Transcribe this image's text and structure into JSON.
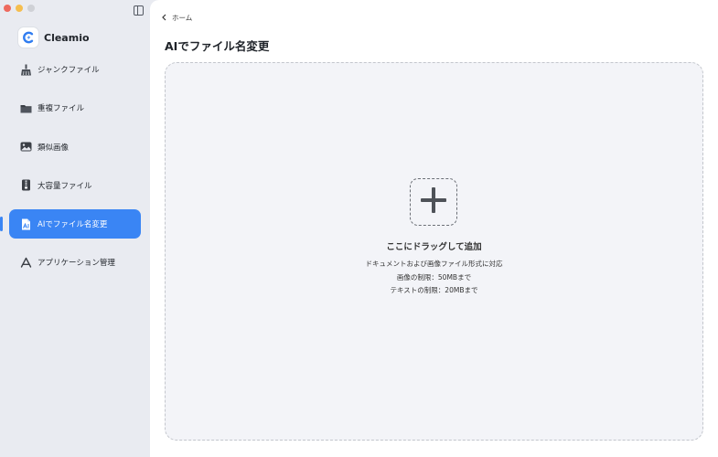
{
  "app": {
    "name": "Cleamio"
  },
  "sidebar": {
    "items": [
      {
        "label": "ジャンクファイル",
        "icon": "broom-icon"
      },
      {
        "label": "重複ファイル",
        "icon": "folder-icon"
      },
      {
        "label": "類似画像",
        "icon": "image-icon"
      },
      {
        "label": "大容量ファイル",
        "icon": "zip-file-icon"
      },
      {
        "label": "AIでファイル名変更",
        "icon": "ai-document-icon",
        "active": true
      },
      {
        "label": "アプリケーション管理",
        "icon": "app-store-icon"
      }
    ]
  },
  "header": {
    "breadcrumb": "ホーム",
    "title": "AIでファイル名変更"
  },
  "dropzone": {
    "title": "ここにドラッグして追加",
    "line1": "ドキュメントおよび画像ファイル形式に対応",
    "line2": "画像の制限：50MBまで",
    "line3": "テキストの制限：20MBまで"
  },
  "colors": {
    "accent": "#3a85f4",
    "sidebar_bg": "#e9ebf1",
    "dropzone_bg": "#f3f4f8"
  }
}
